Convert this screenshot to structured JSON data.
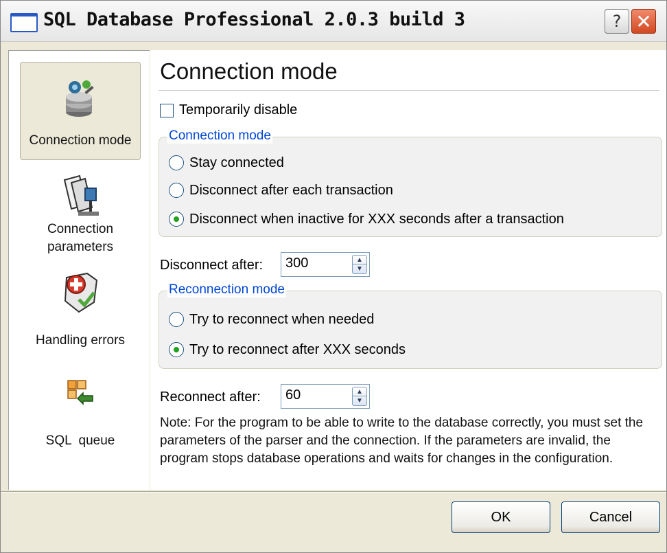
{
  "window": {
    "title": "SQL Database Professional 2.0.3 build 3",
    "help_glyph": "?",
    "close_glyph": "✕"
  },
  "sidebar": {
    "items": [
      {
        "label": "Connection mode",
        "icon": "database-settings-icon",
        "selected": true
      },
      {
        "label": "Connection parameters",
        "label_line1": "Connection",
        "label_line2": "parameters",
        "icon": "network-cards-icon"
      },
      {
        "label": "Handling errors",
        "icon": "shield-error-icon"
      },
      {
        "label": "SQL  queue",
        "icon": "queue-arrow-icon"
      }
    ]
  },
  "main": {
    "heading": "Connection mode",
    "temporarily_disable": {
      "label": "Temporarily disable",
      "checked": false
    },
    "connection_group": {
      "title": "Connection mode",
      "options": [
        {
          "label": "Stay connected",
          "checked": false
        },
        {
          "label": "Disconnect after each transaction",
          "checked": false
        },
        {
          "label": "Disconnect when inactive for XXX seconds after a transaction",
          "checked": true
        }
      ]
    },
    "disconnect_after": {
      "label": "Disconnect after:",
      "value": "300"
    },
    "reconnection_group": {
      "title": "Reconnection mode",
      "options": [
        {
          "label": "Try to reconnect when needed",
          "checked": false
        },
        {
          "label": "Try to reconnect after XXX seconds",
          "checked": true
        }
      ]
    },
    "reconnect_after": {
      "label": "Reconnect after:",
      "value": "60"
    },
    "note": "Note: For the program to be able to write to the database correctly, you must set the parameters of the parser and the connection. If the parameters are invalid, the program stops database operations and waits for changes in the configuration."
  },
  "footer": {
    "ok_label": "OK",
    "cancel_label": "Cancel"
  },
  "colors": {
    "group_title": "#0046d5",
    "radio_dot": "#21a121",
    "dialog_bg": "#ece9d8",
    "close_button": "#d24a22"
  }
}
